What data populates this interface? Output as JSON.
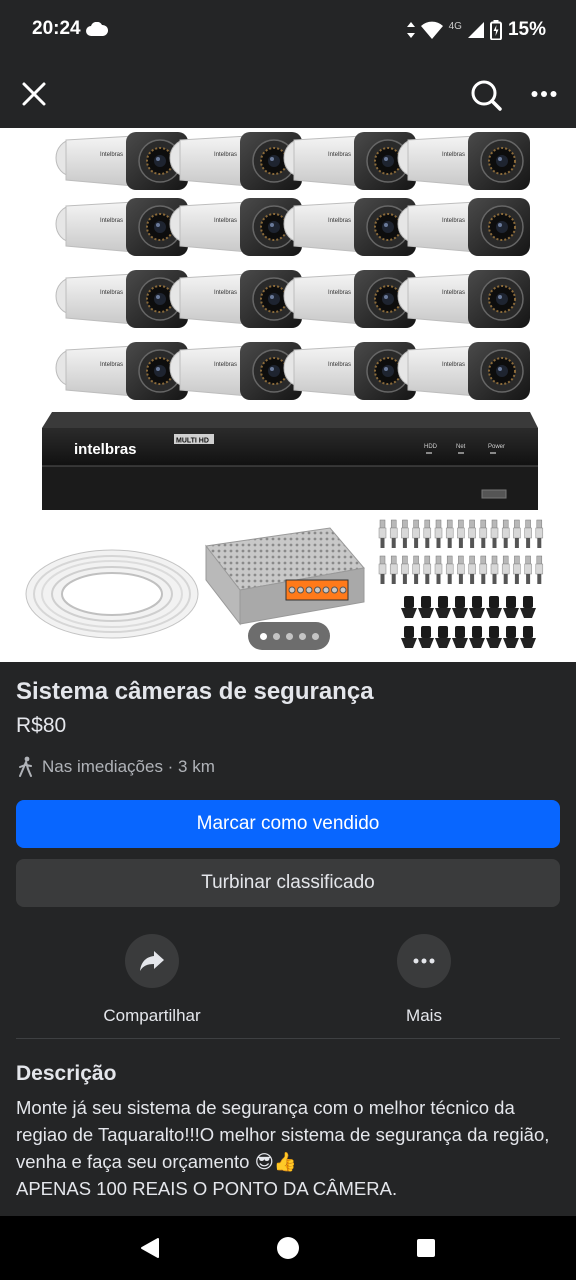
{
  "status_bar": {
    "time": "20:24",
    "network": "4G",
    "battery": "15%",
    "icons": [
      "cloud-icon",
      "data-arrows-icon",
      "wifi-icon",
      "signal-icon",
      "battery-icon"
    ]
  },
  "app_bar": {
    "icons": [
      "close-icon",
      "search-icon",
      "more-horizontal-icon"
    ]
  },
  "photo": {
    "brand_text": "intelbras",
    "dvr_badge": "MULTI HD",
    "dvr_indicators": [
      "HDD",
      "Net",
      "Power"
    ],
    "camera_brand": "Intelbras",
    "pager": {
      "count": 5,
      "active_index": 0
    }
  },
  "listing": {
    "title": "Sistema câmeras de segurança",
    "price": "R$80",
    "location": "Nas imediações · 3 km",
    "location_icon": "walking-person-icon"
  },
  "buttons": {
    "mark_sold": "Marcar como vendido",
    "boost": "Turbinar classificado"
  },
  "actions": {
    "share_label": "Compartilhar",
    "share_icon": "share-arrow-icon",
    "more_label": "Mais",
    "more_icon": "more-horizontal-icon"
  },
  "description": {
    "heading": "Descrição",
    "text": "Monte já seu sistema de segurança com o melhor técnico da regiao de Taquaralto!!!O melhor sistema de segurança da região, venha e faça seu orçamento 😎👍\nAPENAS 100 REAIS O PONTO DA CÂMERA."
  },
  "nav_bar": {
    "icons": [
      "back-triangle-icon",
      "home-circle-icon",
      "recents-square-icon"
    ]
  },
  "colors": {
    "background": "#242526",
    "primary_button": "#0866ff",
    "secondary_button": "#3a3b3c",
    "text_primary": "#e4e6eb",
    "text_secondary": "#b0b3b8"
  }
}
